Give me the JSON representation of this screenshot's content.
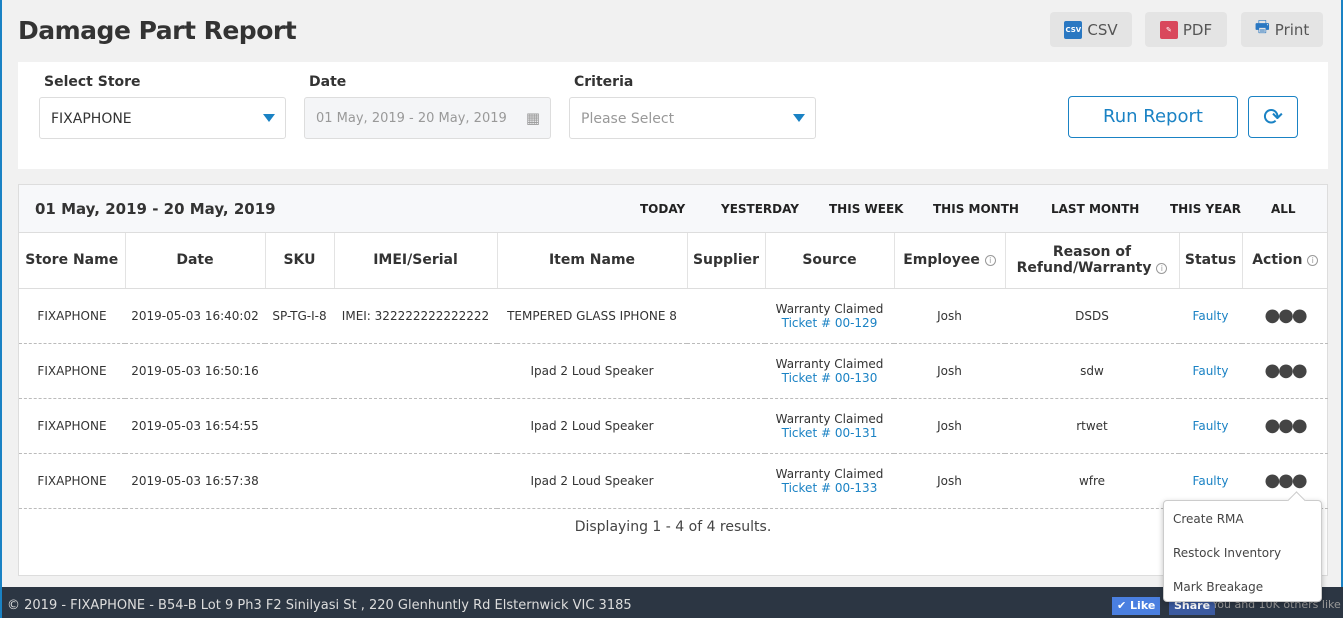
{
  "page": {
    "title": "Damage Part Report"
  },
  "toolbar": {
    "csv": "CSV",
    "csv_icon_text": "CSV",
    "pdf": "PDF",
    "print": "Print"
  },
  "filters": {
    "store_label": "Select Store",
    "store_value": "FIXAPHONE",
    "date_label": "Date",
    "date_value": "01 May, 2019 - 20 May, 2019",
    "criteria_label": "Criteria",
    "criteria_placeholder": "Please Select",
    "run": "Run Report",
    "refresh": "⟳"
  },
  "report": {
    "range": "01 May, 2019 - 20 May, 2019",
    "quick": [
      "TODAY",
      "YESTERDAY",
      "THIS WEEK",
      "THIS MONTH",
      "LAST MONTH",
      "THIS YEAR",
      "ALL"
    ],
    "columns": [
      "Store Name",
      "Date",
      "SKU",
      "IMEI/Serial",
      "Item Name",
      "Supplier",
      "Source",
      "Employee",
      "Reason of Refund/Warranty",
      "Status",
      "Action"
    ],
    "rows": [
      {
        "store": "FIXAPHONE",
        "date": "2019-05-03 16:40:02",
        "sku": "SP-TG-I-8",
        "imei": "IMEI: 322222222222222",
        "item": "TEMPERED GLASS IPHONE 8",
        "supplier": "",
        "source": "Warranty Claimed",
        "ticket": "Ticket # 00-129",
        "employee": "Josh",
        "reason": "DSDS",
        "status": "Faulty"
      },
      {
        "store": "FIXAPHONE",
        "date": "2019-05-03 16:50:16",
        "sku": "",
        "imei": "",
        "item": "Ipad 2 Loud Speaker",
        "supplier": "",
        "source": "Warranty Claimed",
        "ticket": "Ticket # 00-130",
        "employee": "Josh",
        "reason": "sdw",
        "status": "Faulty"
      },
      {
        "store": "FIXAPHONE",
        "date": "2019-05-03 16:54:55",
        "sku": "",
        "imei": "",
        "item": "Ipad 2 Loud Speaker",
        "supplier": "",
        "source": "Warranty Claimed",
        "ticket": "Ticket # 00-131",
        "employee": "Josh",
        "reason": "rtwet",
        "status": "Faulty"
      },
      {
        "store": "FIXAPHONE",
        "date": "2019-05-03 16:57:38",
        "sku": "",
        "imei": "",
        "item": "Ipad 2 Loud Speaker",
        "supplier": "",
        "source": "Warranty Claimed",
        "ticket": "Ticket # 00-133",
        "employee": "Josh",
        "reason": "wfre",
        "status": "Faulty"
      }
    ],
    "summary": "Displaying 1 - 4 of 4 results."
  },
  "action_menu": [
    "Create RMA",
    "Restock Inventory",
    "Mark Breakage"
  ],
  "footer": {
    "text": "© 2019 - FIXAPHONE - B54-B Lot 9 Ph3 F2 Sinilyasi St , 220 Glenhuntly Rd Elsternwick VIC 3185",
    "like": "✔ Like",
    "share": "Share",
    "social": "You and 10K others like"
  },
  "colors": {
    "accent": "#1a82c4",
    "footer": "#2c3643"
  }
}
